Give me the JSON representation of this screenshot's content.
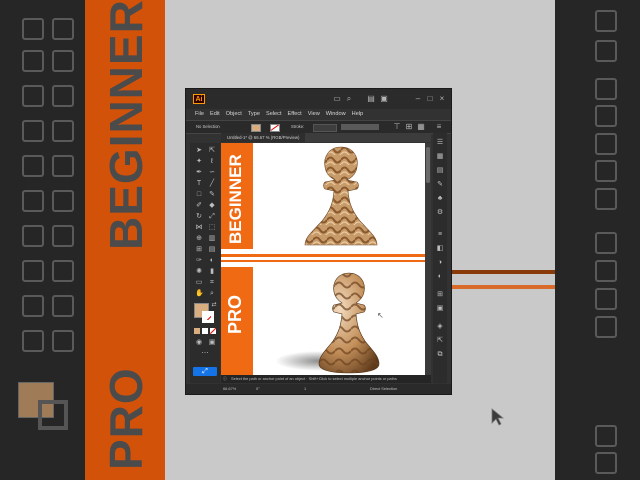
{
  "background": {
    "word_top": "BEGINNER",
    "word_bottom": "PRO"
  },
  "window": {
    "app_logo": "Ai",
    "menu": [
      "File",
      "Edit",
      "Object",
      "Type",
      "Select",
      "Effect",
      "View",
      "Window",
      "Help"
    ],
    "control_bar": {
      "selection": "No Selection",
      "stroke_label": "Stroke:"
    },
    "document_tab": "Untitled-1* @ 66.67 % (RGB/Preview)",
    "artboard": {
      "top_label": "BEGINNER",
      "bottom_label": "PRO",
      "colors": {
        "orange": "#f06a14",
        "white": "#ffffff"
      }
    },
    "status_tip": "Select the path or anchor point of an object · Shift+Click to select multiple anchor points or paths",
    "zoom": "66.67%",
    "rotation": "0°",
    "page": "1",
    "status_mode": "Direct Selection"
  },
  "colors": {
    "fill_swatch": "#d8ad80",
    "accent": "#f06a14",
    "ui_dark": "#323232"
  },
  "icons": [
    "search-icon",
    "arrange-icon",
    "selection-tool-icon",
    "direct-selection-tool-icon",
    "pen-tool-icon",
    "type-tool-icon",
    "shape-tool-icon",
    "brush-tool-icon",
    "eraser-tool-icon",
    "rotate-tool-icon",
    "scale-tool-icon",
    "eyedropper-tool-icon",
    "hand-tool-icon",
    "zoom-tool-icon",
    "swap-colors-icon",
    "mouse-cursor-icon"
  ]
}
